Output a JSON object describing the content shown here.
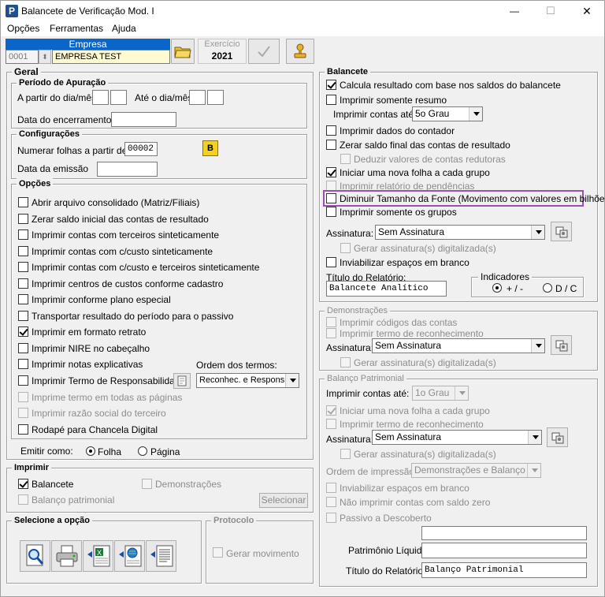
{
  "window": {
    "title": "Balancete de Verificação Mod. I",
    "icon_letter": "P",
    "minimize": "—",
    "maximize": "☐",
    "close": "✕"
  },
  "menu": [
    "Opções",
    "Ferramentas",
    "Ajuda"
  ],
  "empresa": {
    "label": "Empresa",
    "code": "0001",
    "name": "EMPRESA TEST"
  },
  "exercicio": {
    "label": "Exercício",
    "value": "2021"
  },
  "geral": {
    "title": "Geral",
    "periodo": {
      "title": "Período de Apuração",
      "from_label": "A partir do dia/mês",
      "to_label": "Até o dia/mês",
      "closing_label": "Data do encerramento"
    },
    "config": {
      "title": "Configurações",
      "number_label": "Numerar folhas a partir de",
      "number_value": "00002",
      "b_label": "B",
      "emission_label": "Data da emissão"
    },
    "opcoes": {
      "title": "Opções",
      "items": [
        {
          "label": "Abrir arquivo consolidado (Matriz/Filiais)",
          "checked": false,
          "disabled": false
        },
        {
          "label": "Zerar saldo inicial das contas de resultado",
          "checked": false,
          "disabled": false
        },
        {
          "label": "Imprimir contas com terceiros sinteticamente",
          "checked": false,
          "disabled": false
        },
        {
          "label": "Imprimir contas com c/custo sinteticamente",
          "checked": false,
          "disabled": false
        },
        {
          "label": "Imprimir contas com c/custo e terceiros sinteticamente",
          "checked": false,
          "disabled": false
        },
        {
          "label": "Imprimir centros de custos conforme cadastro",
          "checked": false,
          "disabled": false
        },
        {
          "label": "Imprimir conforme plano especial",
          "checked": false,
          "disabled": false
        },
        {
          "label": "Transportar resultado do período para o passivo",
          "checked": false,
          "disabled": false
        },
        {
          "label": "Imprimir em formato retrato",
          "checked": true,
          "disabled": false
        },
        {
          "label": "Imprimir NIRE no cabeçalho",
          "checked": false,
          "disabled": false
        },
        {
          "label": "Imprimir notas explicativas",
          "checked": false,
          "disabled": false
        },
        {
          "label": "Imprimir Termo de Responsabilidade",
          "checked": false,
          "disabled": false
        },
        {
          "label": "Imprime termo em todas as páginas",
          "checked": false,
          "disabled": true
        },
        {
          "label": "Imprimir razão social do terceiro",
          "checked": false,
          "disabled": true
        },
        {
          "label": "Rodapé para Chancela Digital",
          "checked": false,
          "disabled": false
        }
      ],
      "ordem_label": "Ordem dos termos:",
      "ordem_value": "Reconhec. e Respons."
    },
    "emitir": {
      "label": "Emitir como:",
      "folha": "Folha",
      "pagina": "Página"
    }
  },
  "imprimir": {
    "title": "Imprimir",
    "balancete": "Balancete",
    "demonstracoes": "Demonstrações",
    "balanco": "Balanço patrimonial",
    "selecionar": "Selecionar"
  },
  "selecione": {
    "title": "Selecione a opção"
  },
  "protocolo": {
    "title": "Protocolo",
    "gerar": "Gerar movimento"
  },
  "balancete": {
    "title": "Balancete",
    "calcula": "Calcula resultado com base nos saldos do balancete",
    "somente_resumo": "Imprimir somente resumo",
    "contas_ate_label": "Imprimir contas até:",
    "contas_ate_value": "5o Grau",
    "dados_contador": "Imprimir dados do contador",
    "zerar_saldo": "Zerar saldo final das contas de resultado",
    "deduzir": "Deduzir valores de contas redutoras",
    "nova_folha": "Iniciar uma nova folha a cada grupo",
    "pendencias": "Imprimir relatório de pendências",
    "diminuir": "Diminuir Tamanho da Fonte (Movimento com valores em bilhões)",
    "somente_grupos": "Imprimir somente os grupos",
    "assinatura_label": "Assinatura:",
    "assinatura_value": "Sem Assinatura",
    "gerar_assin": "Gerar assinatura(s) digitalizada(s)",
    "inviabilizar": "Inviabilizar espaços em branco",
    "titulo_label": "Título do Relatório:",
    "titulo_value": "Balancete Analítico",
    "indicadores": {
      "title": "Indicadores",
      "opt1": "+ / -",
      "opt2": "D / C"
    }
  },
  "demonstracoes": {
    "title": "Demonstrações",
    "cod_contas": "Imprimir códigos das contas",
    "termo": "Imprimir termo de reconhecimento",
    "assinatura_label": "Assinatura:",
    "assinatura_value": "Sem Assinatura",
    "gerar_assin": "Gerar assinatura(s) digitalizada(s)"
  },
  "balanco": {
    "title": "Balanço Patrimonial",
    "contas_ate_label": "Imprimir contas até:",
    "contas_ate_value": "1o Grau",
    "nova_folha": "Iniciar uma nova folha a cada grupo",
    "termo": "Imprimir termo de reconhecimento",
    "assinatura_label": "Assinatura:",
    "assinatura_value": "Sem Assinatura",
    "gerar_assin": "Gerar assinatura(s) digitalizada(s)",
    "ordem_label": "Ordem de impressão:",
    "ordem_value": "Demonstrações e Balanço",
    "inviabilizar": "Inviabilizar espaços em branco",
    "nao_imprimir": "Não imprimir contas com saldo zero",
    "passivo": "Passivo a Descoberto",
    "patrimonio_label": "Patrimônio Líquido",
    "titulo_label": "Título do Relatório:",
    "titulo_value": "Balanço Patrimonial"
  }
}
